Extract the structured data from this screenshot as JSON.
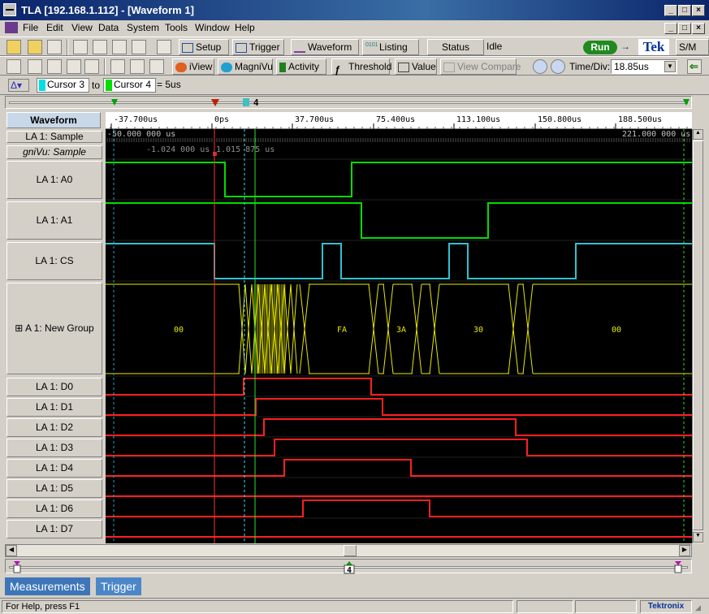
{
  "window": {
    "title": "TLA [192.168.1.112] - [Waveform 1]"
  },
  "menu": [
    "File",
    "Edit",
    "View",
    "Data",
    "System",
    "Tools",
    "Window",
    "Help"
  ],
  "toolbar1": {
    "setup_label": "Setup",
    "trigger_label": "Trigger",
    "waveform_label": "Waveform",
    "listing_label": "Listing",
    "status_label": "Status",
    "status_value": "Idle",
    "run_label": "Run",
    "brand": "Tek",
    "sm_label": "S/M"
  },
  "toolbar2": {
    "iview_label": "iView",
    "magnivu_label": "MagniVu",
    "activity_label": "Activity",
    "threshold_label": "Threshold",
    "value_label": "Value",
    "view_compare_label": "View Compare",
    "timediv_label": "Time/Div:",
    "timediv_value": "18.85us"
  },
  "cursorbar": {
    "from": "Cursor 3",
    "to_label": "to",
    "to": "Cursor 4",
    "delta": "= 5us"
  },
  "waveform": {
    "column_header": "Waveform",
    "time_ticks": [
      "-37.700us",
      "0ps",
      "37.700us",
      "75.400us",
      "113.100us",
      "150.800us",
      "188.500us"
    ],
    "range_start": "-50.000 000 us",
    "range_end": "221.000 000 us",
    "sample_readout_1": "-1.024 000 us",
    "sample_readout_2": "1.015 875 us",
    "cursor_4_label": "4",
    "rows": [
      {
        "label": "LA 1: Sample"
      },
      {
        "label": "gniVu: Sample"
      },
      {
        "label": "LA 1: A0"
      },
      {
        "label": "LA 1: A1"
      },
      {
        "label": "LA 1: CS"
      },
      {
        "label": "A 1: New Group"
      },
      {
        "label": "LA 1: D0"
      },
      {
        "label": "LA 1: D1"
      },
      {
        "label": "LA 1: D2"
      },
      {
        "label": "LA 1: D3"
      },
      {
        "label": "LA 1: D4"
      },
      {
        "label": "LA 1: D5"
      },
      {
        "label": "LA 1: D6"
      },
      {
        "label": "LA 1: D7"
      }
    ],
    "bus_values": [
      "00",
      "FA",
      "3A",
      "30",
      "00"
    ]
  },
  "tabs": [
    "Measurements",
    "Trigger"
  ],
  "status": {
    "help": "For Help, press F1",
    "brand": "Tektronix"
  }
}
